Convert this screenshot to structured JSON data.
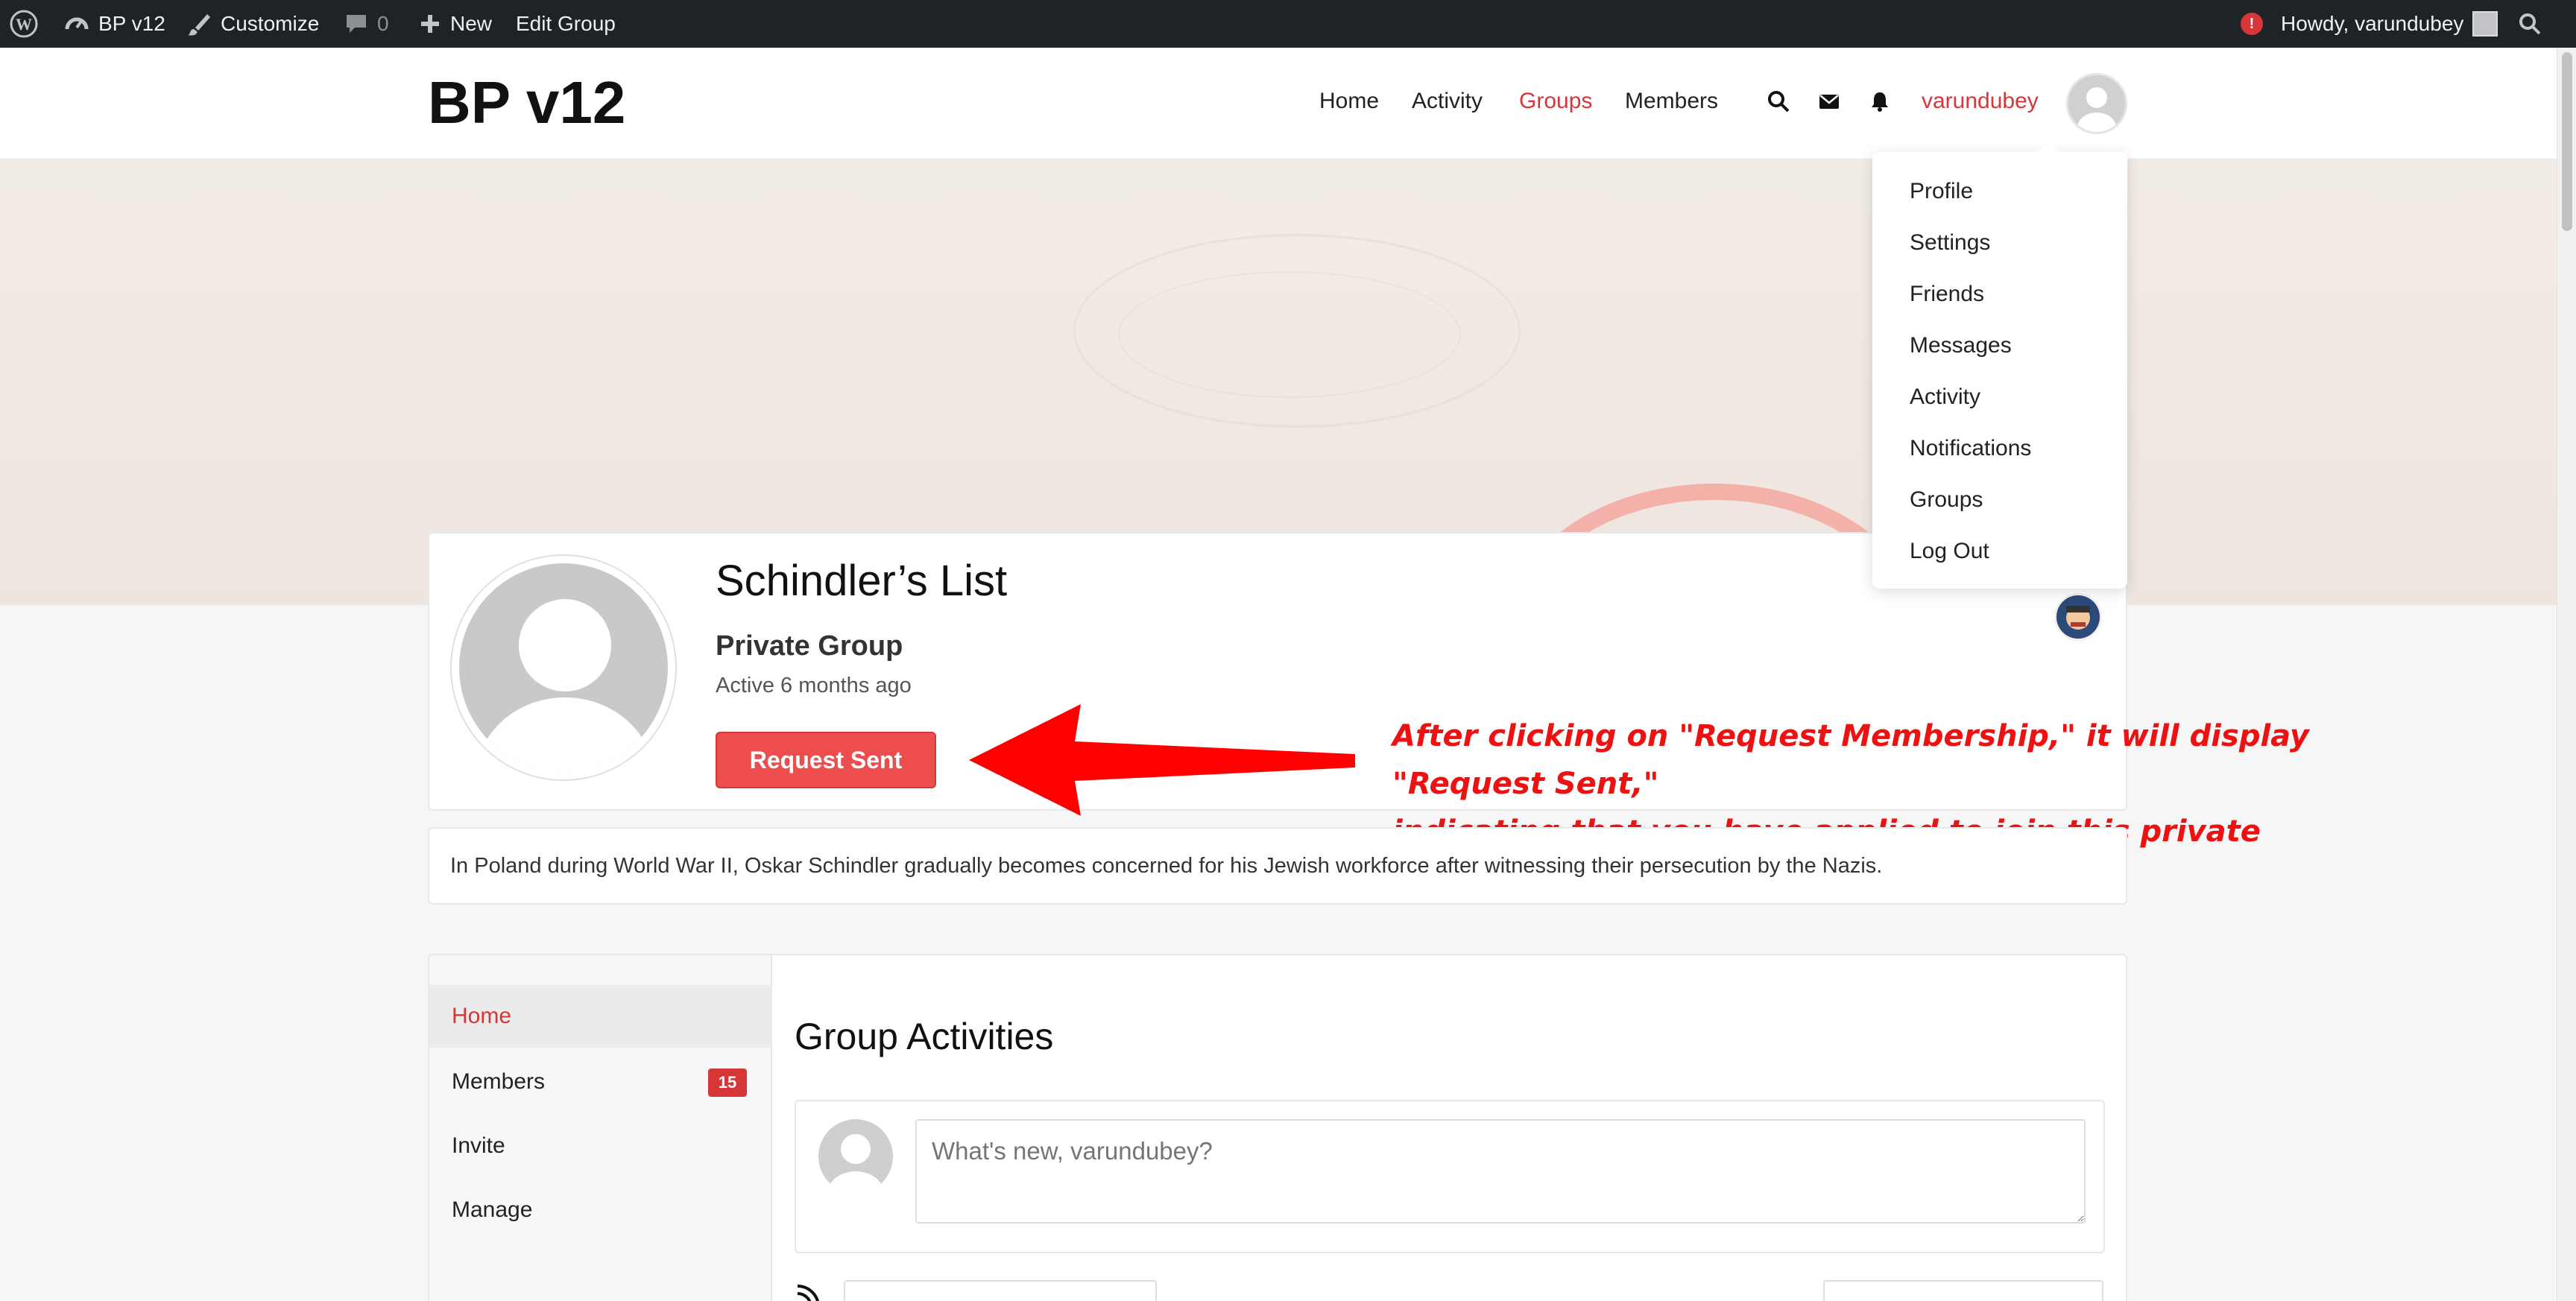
{
  "admin_bar": {
    "site_name": "BP v12",
    "customize": "Customize",
    "comments_count": "0",
    "new_label": "New",
    "edit_group": "Edit Group",
    "notification_count": "!",
    "howdy": "Howdy, varundubey"
  },
  "header": {
    "site_title": "BP v12",
    "nav": [
      "Home",
      "Activity",
      "Groups",
      "Members"
    ],
    "active_nav": "Groups",
    "username": "varundubey"
  },
  "user_menu": {
    "items": [
      "Profile",
      "Settings",
      "Friends",
      "Messages",
      "Activity",
      "Notifications",
      "Groups",
      "Log Out"
    ]
  },
  "group": {
    "name": "Schindler’s List",
    "type": "Private Group",
    "last_active": "Active 6 months ago",
    "request_button": "Request Sent",
    "description": "In Poland during World War II, Oskar Schindler gradually becomes concerned for his Jewish workforce after witnessing their persecution by the Nazis."
  },
  "annotation": {
    "line1": "After clicking on \"Request Membership,\" it will display \"Request Sent,\"",
    "line2": "indicating that you have applied to join this private group."
  },
  "group_nav": {
    "items": [
      {
        "label": "Home",
        "active": true
      },
      {
        "label": "Members",
        "badge": "15"
      },
      {
        "label": "Invite"
      },
      {
        "label": "Manage"
      }
    ]
  },
  "activity": {
    "title": "Group Activities",
    "post_placeholder": "What's new, varundubey?"
  },
  "colors": {
    "accent": "#d63638",
    "admin_bar": "#1d2327",
    "button": "#ee4d4d",
    "annotation": "#ee1111"
  }
}
